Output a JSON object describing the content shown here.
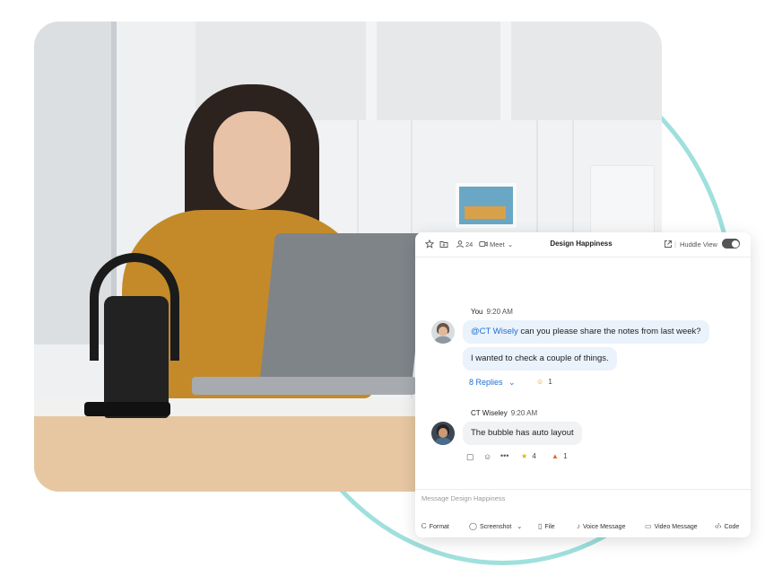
{
  "header": {
    "member_count": "24",
    "meet_label": "Meet",
    "title": "Design Happiness",
    "huddle_label": "Huddle View",
    "huddle_toggle": "off"
  },
  "messages": [
    {
      "sender": "You",
      "time": "9:20 AM",
      "mention": "@CT Wisely",
      "text": " can you please share the notes from last week?",
      "text2": "I wanted to check a couple of things.",
      "replies": "8 Replies",
      "reaction_count": "1"
    },
    {
      "sender": "CT Wiseley",
      "time": "9:20 AM",
      "text": "The bubble has auto layout",
      "star_count": "4",
      "fire_count": "1"
    }
  ],
  "composer": {
    "placeholder": "Message Design Happiness",
    "tools": [
      "Format",
      "Screenshot",
      "File",
      "Voice Message",
      "Video Message",
      "Code"
    ]
  },
  "colors": {
    "accent": "#1d6fd6",
    "ring": "#9fe0dd",
    "bubble_blue": "#eaf2fc",
    "bubble_grey": "#f1f2f4"
  }
}
